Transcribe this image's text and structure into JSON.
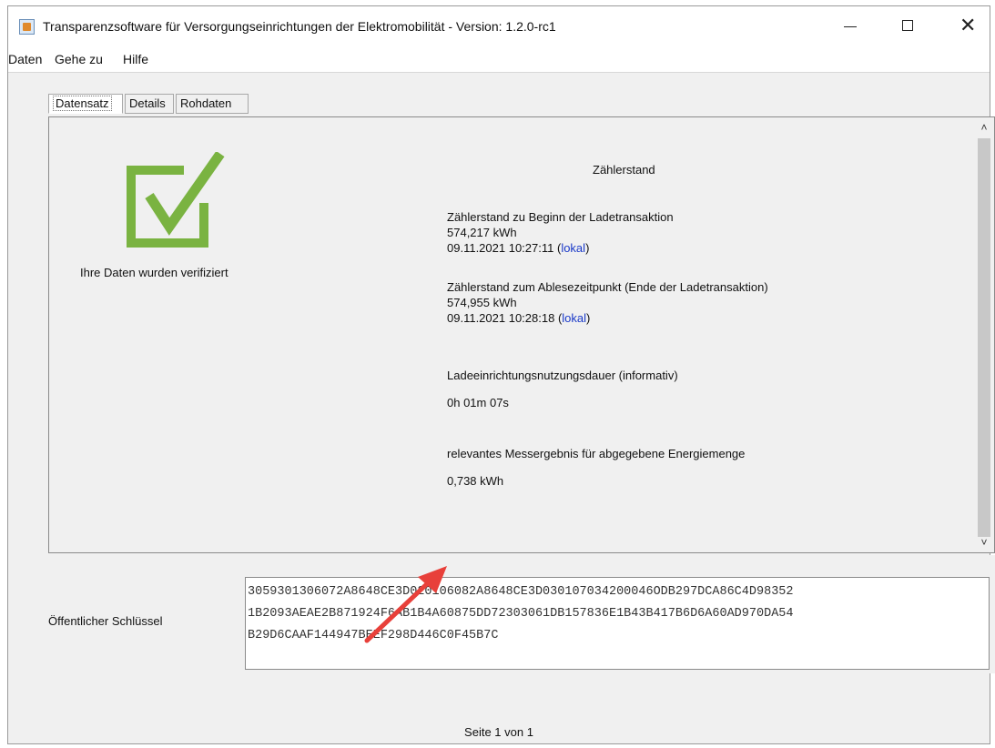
{
  "window": {
    "title": "Transparenzsoftware für Versorgungseinrichtungen der Elektromobilität - Version: 1.2.0-rc1",
    "minimize_icon": "minimize-icon",
    "maximize_icon": "maximize-icon",
    "close_icon": "close-icon",
    "close_glyph": "✕"
  },
  "menu": {
    "items": [
      {
        "label": "Daten"
      },
      {
        "label": "Gehe zu"
      },
      {
        "label": "Hilfe"
      }
    ]
  },
  "tabs": [
    {
      "label": "Datensatz",
      "active": true
    },
    {
      "label": "Details",
      "active": false
    },
    {
      "label": "Rohdaten",
      "active": false
    }
  ],
  "status": {
    "icon": "checkmark-icon",
    "color": "#7ab341",
    "text": "Ihre Daten wurden verifiziert"
  },
  "meter": {
    "heading": "Zählerstand",
    "start": {
      "label": "Zählerstand zu Beginn der Ladetransaktion",
      "value": "574,217 kWh",
      "timestamp": "09.11.2021 10:27:11",
      "open_paren": " (",
      "link": "lokal",
      "close_paren": ")"
    },
    "end": {
      "label": "Zählerstand zum Ablesezeitpunkt (Ende der Ladetransaktion)",
      "value": "574,955 kWh",
      "timestamp": "09.11.2021 10:28:18",
      "open_paren": " (",
      "link": "lokal",
      "close_paren": ")"
    },
    "duration_label": "Ladeeinrichtungsnutzungsdauer (informativ)",
    "duration_value": "0h 01m 07s",
    "result_label": "relevantes Messergebnis für abgegebene Energiemenge",
    "result_value": "0,738 kWh"
  },
  "scrollbar": {
    "up_glyph": "˄",
    "down_glyph": "˅"
  },
  "annotation": {
    "arrow_color": "#e8403a"
  },
  "public_key": {
    "label": "Öffentlicher Schlüssel",
    "line1": "3059301306072A8648CE3D020106082A8648CE3D030107034200046ODB297DCA86C4D98352",
    "line2": "1B2093AEAE2B871924F6AB1B4A60875DD72303061DB157836E1B43B417B6D6A60AD970DA54",
    "line3": "B29D6CAAF144947BEEF298D446C0F45B7C"
  },
  "footer": {
    "page_info": "Seite 1 von 1"
  }
}
